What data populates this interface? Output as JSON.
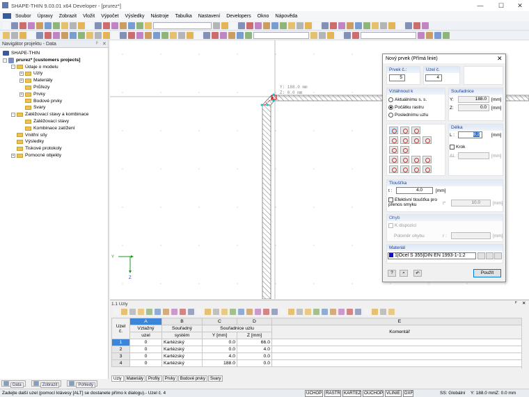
{
  "window": {
    "title": "SHAPE-THIN 9.03.01 x64 Developer - [prurez*]"
  },
  "menu": [
    "Soubor",
    "Úpravy",
    "Zobrazit",
    "Vložit",
    "Výpočet",
    "Výsledky",
    "Nástroje",
    "Tabulka",
    "Nastavení",
    "Developers",
    "Okno",
    "Nápověda"
  ],
  "navigator": {
    "title": "Navigátor projektu - Data",
    "root": "SHAPE-THIN",
    "project": "prurez* [customers projects]",
    "items": [
      {
        "label": "Údaje o modelu",
        "level": 1,
        "pm": "-"
      },
      {
        "label": "Uzly",
        "level": 2,
        "pm": "+"
      },
      {
        "label": "Materiály",
        "level": 2,
        "pm": "+"
      },
      {
        "label": "Průřezy",
        "level": 2,
        "pm": ""
      },
      {
        "label": "Prvky",
        "level": 2,
        "pm": "+"
      },
      {
        "label": "Bodové prvky",
        "level": 2,
        "pm": ""
      },
      {
        "label": "Svary",
        "level": 2,
        "pm": ""
      },
      {
        "label": "Zatěžovací stavy a kombinace",
        "level": 1,
        "pm": "-"
      },
      {
        "label": "Zatěžovací stavy",
        "level": 2,
        "pm": ""
      },
      {
        "label": "Kombinace zatížení",
        "level": 2,
        "pm": ""
      },
      {
        "label": "Vnitřní síly",
        "level": 1,
        "pm": ""
      },
      {
        "label": "Výsledky",
        "level": 1,
        "pm": ""
      },
      {
        "label": "Tiskové protokoly",
        "level": 1,
        "pm": ""
      },
      {
        "label": "Pomocné objekty",
        "level": 1,
        "pm": "+"
      }
    ],
    "tabs": [
      "Data",
      "Zobrazit",
      "Pohledy"
    ]
  },
  "canvas": {
    "cursor_y": "Y: 188.0 mm",
    "cursor_z": "Z:   0.0 mm",
    "axis_y": "Y",
    "axis_z": "Z"
  },
  "dialog": {
    "title": "Nový prvek (Přímá linie)",
    "prvek_label": "Prvek č.:",
    "prvek_value": "5",
    "uzel_label": "Uzel č.",
    "uzel_value": "4",
    "vztahnout_label": "Vztáhnout k",
    "options": [
      "Aktuálnímu s. s.",
      "Počátku rastru",
      "Poslednímu uzlu"
    ],
    "selected_option": 1,
    "souradnice_label": "Souřadnice",
    "y_label": "Y:",
    "y_value": "188.0",
    "z_label": "Z:",
    "z_value": "0.0",
    "unit": "[mm]",
    "delka_label": "Délka",
    "l_label": "L :",
    "l_value": "8.2",
    "krok_label": "Krok",
    "dl_label": "ΔL :",
    "tloustka_label": "Tloušťka",
    "t_label": "t :",
    "t_value": "4.0",
    "eff_label": "Efektivní tloušťka pro přenos smyku",
    "teff_label": "t*",
    "teff_value": "10.0",
    "ohyb_label": "Ohyb",
    "k_dispozici": "K dispozici",
    "polomer_label": "Poloměr ohybu",
    "r_label": "r :",
    "material_label": "Materiál",
    "material_no": "1",
    "material_name": "Ocel S 355",
    "material_norm": "DIN EN 1993-1-1:2",
    "material_color": "#1010c0",
    "apply": "Použít"
  },
  "table": {
    "title": "1.1 Uzly",
    "col_letters": [
      "A",
      "B",
      "C",
      "D",
      "E"
    ],
    "headers": {
      "uzel": "Uzel č.",
      "uzel1": "Uzel",
      "uzel2": "č.",
      "vztazny1": "Vztažný",
      "vztazny2": "uzel",
      "system1": "Souřadný",
      "system2": "systém",
      "coords": "Souřadnice uzlu",
      "y": "Y [mm]",
      "z": "Z [mm]",
      "comment": "Komentář"
    },
    "rows": [
      {
        "no": "1",
        "ref": "0",
        "sys": "Kartézský",
        "y": "0.0",
        "z": "66.0"
      },
      {
        "no": "2",
        "ref": "0",
        "sys": "Kartézský",
        "y": "0.0",
        "z": "4.0"
      },
      {
        "no": "3",
        "ref": "0",
        "sys": "Kartézský",
        "y": "4.0",
        "z": "0.0"
      },
      {
        "no": "4",
        "ref": "0",
        "sys": "Kartézský",
        "y": "188.0",
        "z": "0.0"
      }
    ],
    "tabs": [
      "Uzly",
      "Materiály",
      "Profily",
      "Prvky",
      "Bodové prvky",
      "Svary"
    ]
  },
  "status": {
    "message": "Zadejte další uzel (pomocí klávesy [ALT] se dostanete přímo k dialogu).- Uzel č. 4",
    "toggles": [
      "UCHOP",
      "RASTR",
      "KARTEZ",
      "OUCHOP",
      "VLINIE",
      "DXF"
    ],
    "ss": "SS: Globální",
    "y": "Y: 188.0 mm",
    "z": "Z: 0.0 mm"
  }
}
